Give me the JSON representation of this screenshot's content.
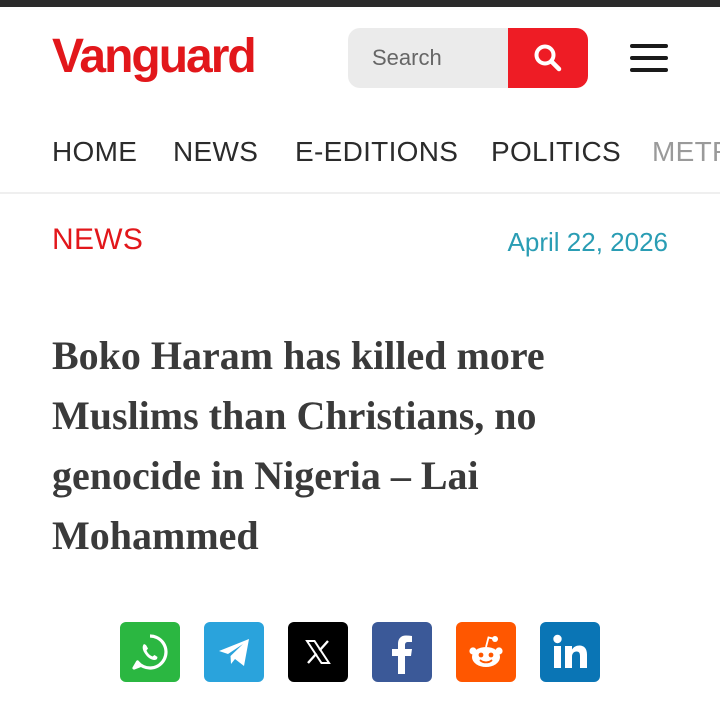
{
  "header": {
    "logo_text": "Vanguard",
    "search": {
      "placeholder": "Search"
    }
  },
  "nav": {
    "items": [
      "HOME",
      "NEWS",
      "E-EDITIONS",
      "POLITICS",
      "METRO"
    ]
  },
  "article": {
    "category": "NEWS",
    "date": "April 22, 2026",
    "headline": "Boko Haram has killed more Muslims than Christians, no genocide in Nigeria – Lai Mohammed"
  },
  "share": {
    "buttons": [
      {
        "icon": "whatsapp-icon",
        "color": "#2bb741"
      },
      {
        "icon": "telegram-icon",
        "color": "#2aa3dc"
      },
      {
        "icon": "x-icon",
        "color": "#000000"
      },
      {
        "icon": "facebook-icon",
        "color": "#3b5998"
      },
      {
        "icon": "reddit-icon",
        "color": "#ff5700"
      },
      {
        "icon": "linkedin-icon",
        "color": "#0a75b5"
      }
    ]
  },
  "colors": {
    "brand_red": "#e2171b",
    "search_button": "#ee1c25",
    "date_teal": "#2a9db4",
    "headline": "#3a3a3a"
  }
}
